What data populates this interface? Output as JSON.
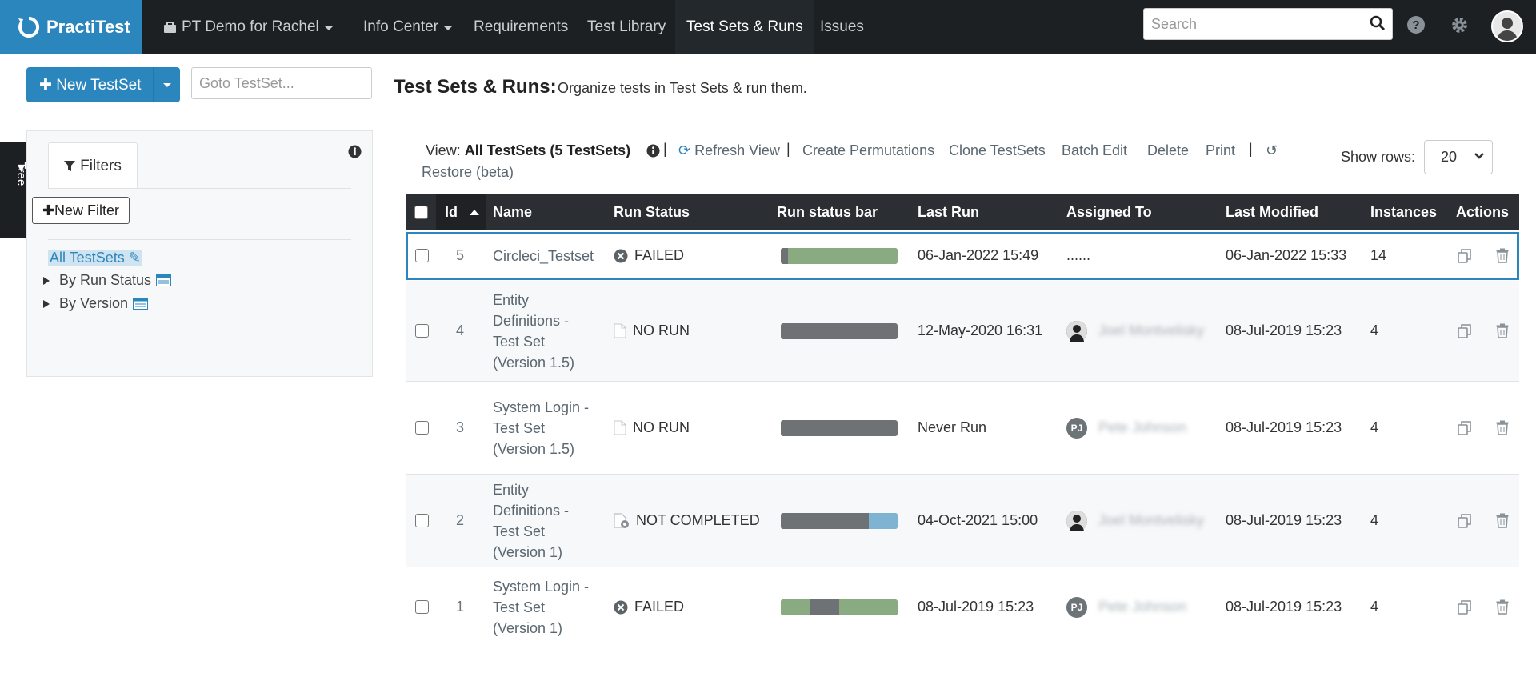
{
  "app": {
    "name": "PractiTest"
  },
  "nav": {
    "project": "PT Demo for Rachel",
    "items": [
      "Info Center",
      "Requirements",
      "Test Library",
      "Test Sets & Runs",
      "Issues"
    ]
  },
  "search": {
    "placeholder": "Search"
  },
  "toolbar": {
    "new_testset": "New TestSet",
    "goto_placeholder": "Goto TestSet...",
    "title": "Test Sets & Runs:",
    "subtitle": "Organize tests in Test Sets & run them."
  },
  "side_tab": {
    "label": "Filter Tree"
  },
  "filters": {
    "tab_label": "Filters",
    "new_filter": "New Filter",
    "all": "All TestSets",
    "nodes": [
      "By Run Status",
      "By Version"
    ]
  },
  "view": {
    "prefix": "View:",
    "name": "All TestSets (5 TestSets)",
    "actions": [
      "Refresh View",
      "Create Permutations",
      "Clone TestSets",
      "Batch Edit",
      "Delete",
      "Print"
    ],
    "restore": "Restore (beta)",
    "show_rows_label": "Show rows:",
    "show_rows_value": "20"
  },
  "table": {
    "headers": [
      "Id",
      "Name",
      "Run Status",
      "Run status bar",
      "Last Run",
      "Assigned To",
      "Last Modified",
      "Instances",
      "Actions"
    ],
    "rows": [
      {
        "id": "5",
        "name": [
          "Circleci_Testset"
        ],
        "status": "FAILED",
        "status_icon": "failed-icon",
        "bar": [
          {
            "color": "#6e7275",
            "pct": 6
          },
          {
            "color": "#8aab82",
            "pct": 94
          }
        ],
        "last_run": "06-Jan-2022 15:49",
        "assigned_initials": "",
        "assigned": "......",
        "last_modified": "06-Jan-2022 15:33",
        "instances": "14"
      },
      {
        "id": "4",
        "name": [
          "Entity",
          "Definitions -",
          "Test Set",
          "(Version 1.5)"
        ],
        "status": "NO RUN",
        "status_icon": "no-run-icon",
        "bar": [
          {
            "color": "#6e7275",
            "pct": 100
          }
        ],
        "last_run": "12-May-2020 16:31",
        "assigned_initials": "photo",
        "assigned": "Joel Montvelisky",
        "last_modified": "08-Jul-2019 15:23",
        "instances": "4"
      },
      {
        "id": "3",
        "name": [
          "System Login -",
          "Test Set",
          "(Version 1.5)"
        ],
        "status": "NO RUN",
        "status_icon": "no-run-icon",
        "bar": [
          {
            "color": "#6e7275",
            "pct": 100
          }
        ],
        "last_run": "Never Run",
        "assigned_initials": "PJ",
        "assigned": "Pete Johnson",
        "last_modified": "08-Jul-2019 15:23",
        "instances": "4"
      },
      {
        "id": "2",
        "name": [
          "Entity",
          "Definitions -",
          "Test Set",
          "(Version 1)"
        ],
        "status": "NOT COMPLETED",
        "status_icon": "not-completed-icon",
        "bar": [
          {
            "color": "#6e7275",
            "pct": 75
          },
          {
            "color": "#7fb3d2",
            "pct": 25
          }
        ],
        "last_run": "04-Oct-2021 15:00",
        "assigned_initials": "photo",
        "assigned": "Joel Montvelisky",
        "last_modified": "08-Jul-2019 15:23",
        "instances": "4"
      },
      {
        "id": "1",
        "name": [
          "System Login -",
          "Test Set",
          "(Version 1)"
        ],
        "status": "FAILED",
        "status_icon": "failed-icon",
        "bar": [
          {
            "color": "#8aab82",
            "pct": 25
          },
          {
            "color": "#6e7275",
            "pct": 25
          },
          {
            "color": "#8aab82",
            "pct": 50
          }
        ],
        "last_run": "08-Jul-2019 15:23",
        "assigned_initials": "PJ",
        "assigned": "Pete Johnson",
        "last_modified": "08-Jul-2019 15:23",
        "instances": "4"
      }
    ]
  },
  "colors": {
    "brand": "#2a86bd",
    "topbar": "#1c2023",
    "passed": "#8aab82",
    "no_run": "#6e7275",
    "not_completed": "#7fb3d2"
  }
}
